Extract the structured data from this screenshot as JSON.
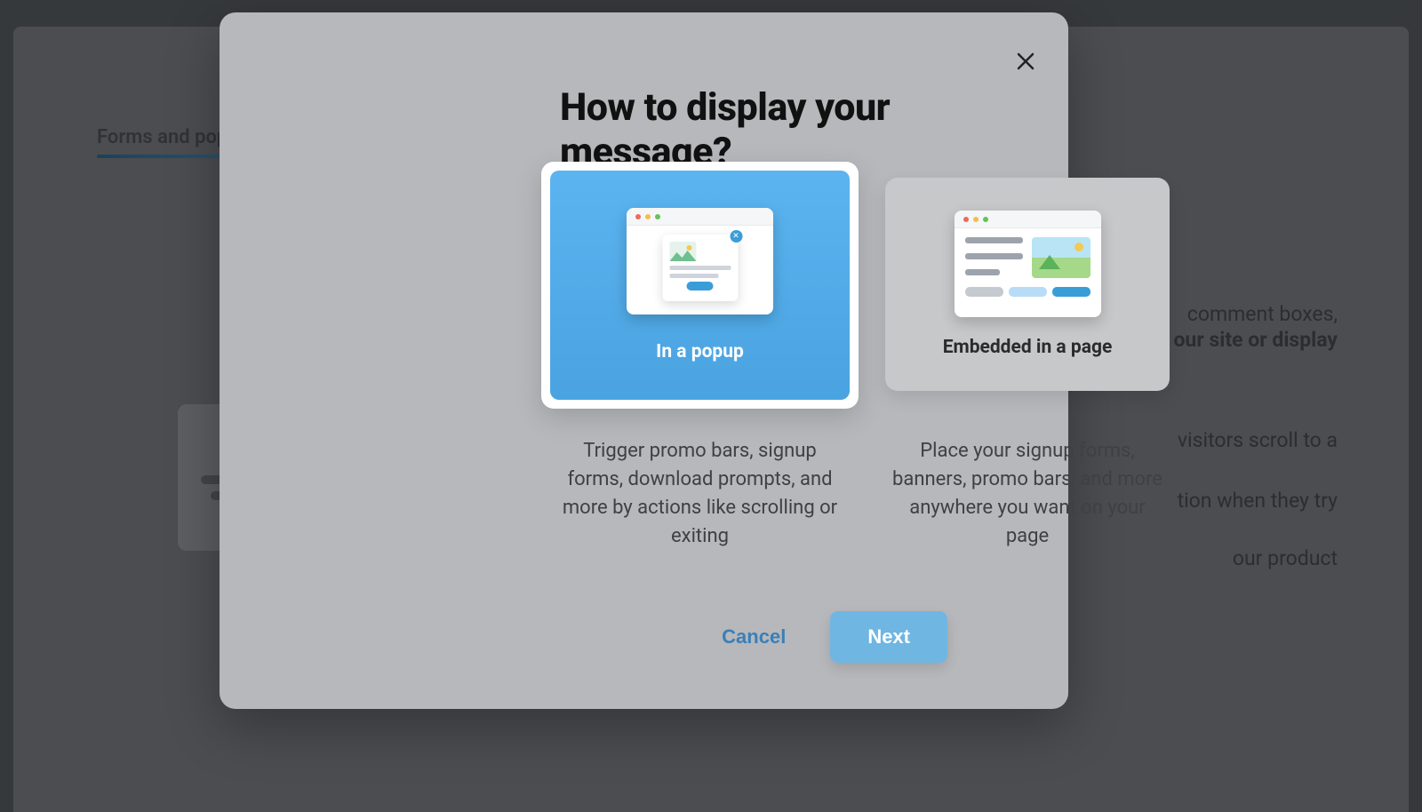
{
  "background": {
    "tab_label": "Forms and popups",
    "right_text_1": "comment boxes,",
    "right_text_2": "our site or display",
    "right_text_3": "visitors scroll to a",
    "right_text_4": "tion when they try",
    "right_text_5": "our product"
  },
  "modal": {
    "title": "How to display your message?",
    "option_popup": {
      "title": "In a popup",
      "description": "Trigger promo bars, signup forms, download prompts, and more by actions like scrolling or exiting"
    },
    "option_embedded": {
      "title": "Embedded in a page",
      "description": "Place your signup forms, banners, promo bars, and more anywhere you want on your page"
    },
    "cancel_label": "Cancel",
    "next_label": "Next"
  }
}
